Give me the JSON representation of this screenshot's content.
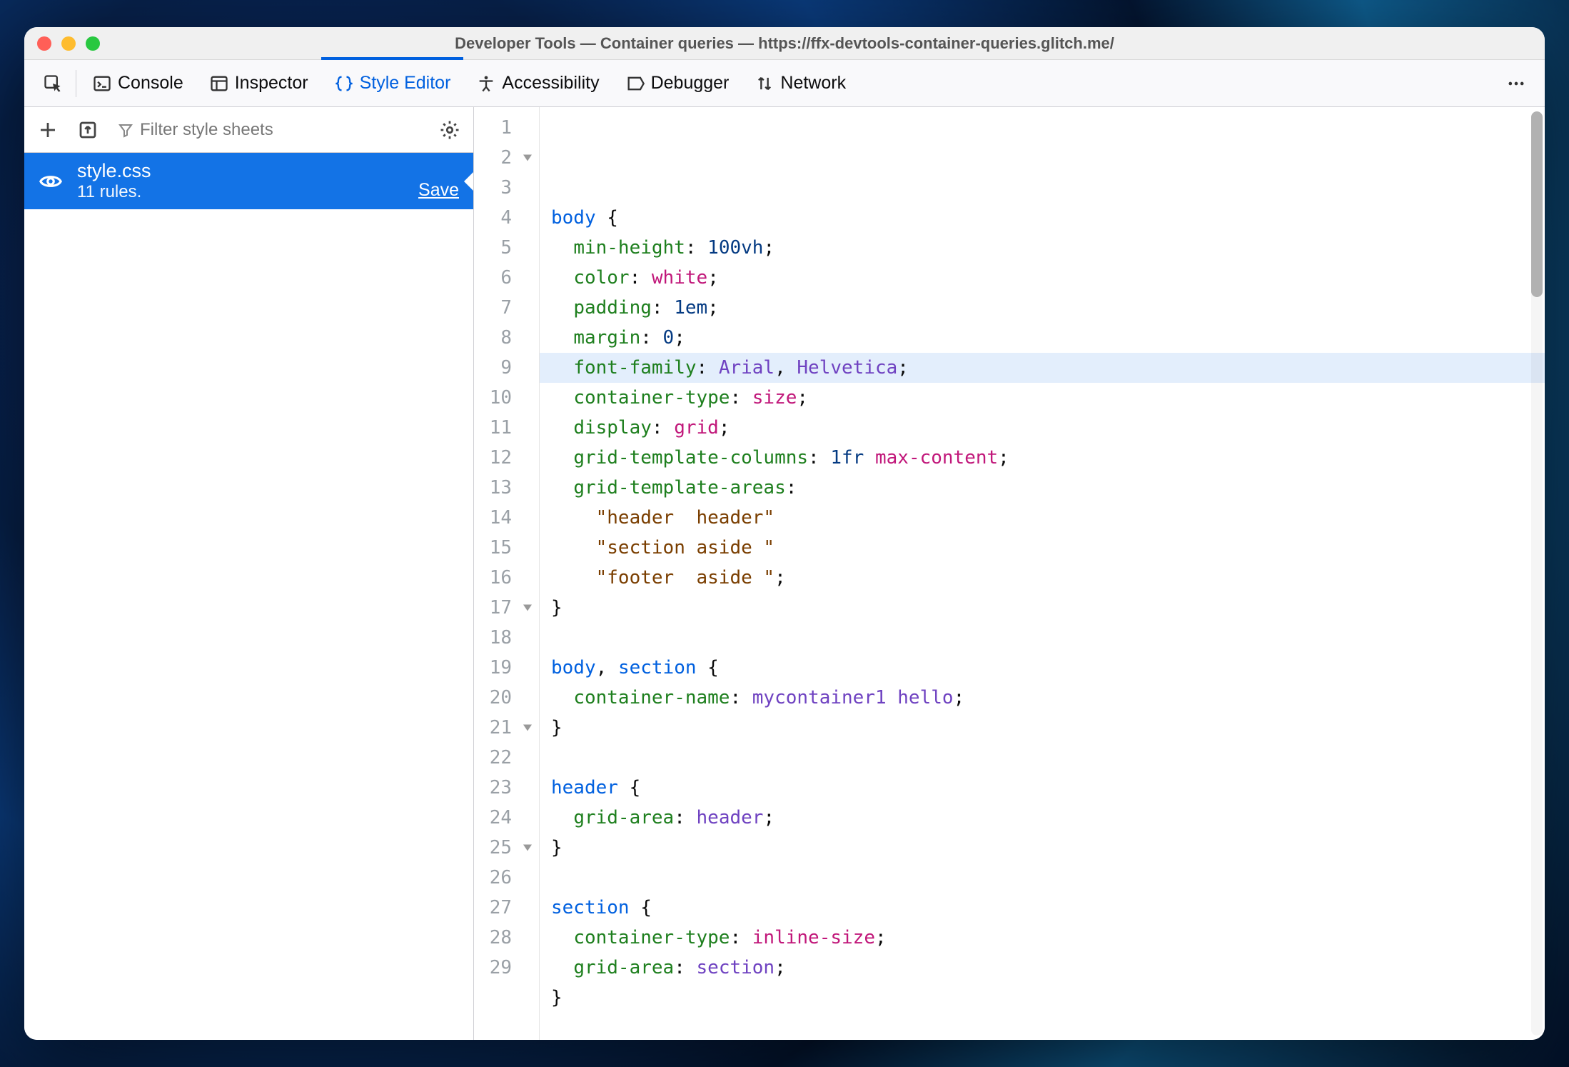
{
  "window": {
    "title": "Developer Tools — Container queries — https://ffx-devtools-container-queries.glitch.me/"
  },
  "toolbar": {
    "console": "Console",
    "inspector": "Inspector",
    "styleeditor": "Style Editor",
    "accessibility": "Accessibility",
    "debugger": "Debugger",
    "network": "Network",
    "active": "styleeditor"
  },
  "sidebar": {
    "filter_placeholder": "Filter style sheets",
    "items": [
      {
        "name": "style.css",
        "rules": "11 rules.",
        "save": "Save"
      }
    ]
  },
  "editor": {
    "highlighted_line": 7,
    "foldable_lines": [
      2,
      17,
      21,
      25
    ],
    "line_count": 29,
    "lines": [
      [],
      [
        [
          "sel",
          "body"
        ],
        [
          "punc",
          " "
        ],
        [
          "brace",
          "{"
        ]
      ],
      [
        [
          "ws",
          "  "
        ],
        [
          "prop",
          "min-height"
        ],
        [
          "punc",
          ": "
        ],
        [
          "num",
          "100vh"
        ],
        [
          "punc",
          ";"
        ]
      ],
      [
        [
          "ws",
          "  "
        ],
        [
          "prop",
          "color"
        ],
        [
          "punc",
          ": "
        ],
        [
          "kw",
          "white"
        ],
        [
          "punc",
          ";"
        ]
      ],
      [
        [
          "ws",
          "  "
        ],
        [
          "prop",
          "padding"
        ],
        [
          "punc",
          ": "
        ],
        [
          "num",
          "1em"
        ],
        [
          "punc",
          ";"
        ]
      ],
      [
        [
          "ws",
          "  "
        ],
        [
          "prop",
          "margin"
        ],
        [
          "punc",
          ": "
        ],
        [
          "num",
          "0"
        ],
        [
          "punc",
          ";"
        ]
      ],
      [
        [
          "ws",
          "  "
        ],
        [
          "prop",
          "font-family"
        ],
        [
          "punc",
          ": "
        ],
        [
          "ident",
          "Arial"
        ],
        [
          "punc",
          ", "
        ],
        [
          "ident",
          "Helvetica"
        ],
        [
          "punc",
          ";"
        ]
      ],
      [
        [
          "ws",
          "  "
        ],
        [
          "prop",
          "container-type"
        ],
        [
          "punc",
          ": "
        ],
        [
          "kw",
          "size"
        ],
        [
          "punc",
          ";"
        ]
      ],
      [
        [
          "ws",
          "  "
        ],
        [
          "prop",
          "display"
        ],
        [
          "punc",
          ": "
        ],
        [
          "kw",
          "grid"
        ],
        [
          "punc",
          ";"
        ]
      ],
      [
        [
          "ws",
          "  "
        ],
        [
          "prop",
          "grid-template-columns"
        ],
        [
          "punc",
          ": "
        ],
        [
          "num",
          "1fr"
        ],
        [
          "punc",
          " "
        ],
        [
          "kw",
          "max-content"
        ],
        [
          "punc",
          ";"
        ]
      ],
      [
        [
          "ws",
          "  "
        ],
        [
          "prop",
          "grid-template-areas"
        ],
        [
          "punc",
          ":"
        ]
      ],
      [
        [
          "ws",
          "    "
        ],
        [
          "str",
          "\"header  header\""
        ]
      ],
      [
        [
          "ws",
          "    "
        ],
        [
          "str",
          "\"section aside \""
        ]
      ],
      [
        [
          "ws",
          "    "
        ],
        [
          "str",
          "\"footer  aside \""
        ],
        [
          "punc",
          ";"
        ]
      ],
      [
        [
          "brace",
          "}"
        ]
      ],
      [],
      [
        [
          "sel",
          "body"
        ],
        [
          "punc",
          ", "
        ],
        [
          "sel",
          "section"
        ],
        [
          "punc",
          " "
        ],
        [
          "brace",
          "{"
        ]
      ],
      [
        [
          "ws",
          "  "
        ],
        [
          "prop",
          "container-name"
        ],
        [
          "punc",
          ": "
        ],
        [
          "ident",
          "mycontainer1"
        ],
        [
          "punc",
          " "
        ],
        [
          "ident",
          "hello"
        ],
        [
          "punc",
          ";"
        ]
      ],
      [
        [
          "brace",
          "}"
        ]
      ],
      [],
      [
        [
          "sel",
          "header"
        ],
        [
          "punc",
          " "
        ],
        [
          "brace",
          "{"
        ]
      ],
      [
        [
          "ws",
          "  "
        ],
        [
          "prop",
          "grid-area"
        ],
        [
          "punc",
          ": "
        ],
        [
          "ident",
          "header"
        ],
        [
          "punc",
          ";"
        ]
      ],
      [
        [
          "brace",
          "}"
        ]
      ],
      [],
      [
        [
          "sel",
          "section"
        ],
        [
          "punc",
          " "
        ],
        [
          "brace",
          "{"
        ]
      ],
      [
        [
          "ws",
          "  "
        ],
        [
          "prop",
          "container-type"
        ],
        [
          "punc",
          ": "
        ],
        [
          "kw",
          "inline-size"
        ],
        [
          "punc",
          ";"
        ]
      ],
      [
        [
          "ws",
          "  "
        ],
        [
          "prop",
          "grid-area"
        ],
        [
          "punc",
          ": "
        ],
        [
          "ident",
          "section"
        ],
        [
          "punc",
          ";"
        ]
      ],
      [
        [
          "brace",
          "}"
        ]
      ],
      []
    ]
  }
}
